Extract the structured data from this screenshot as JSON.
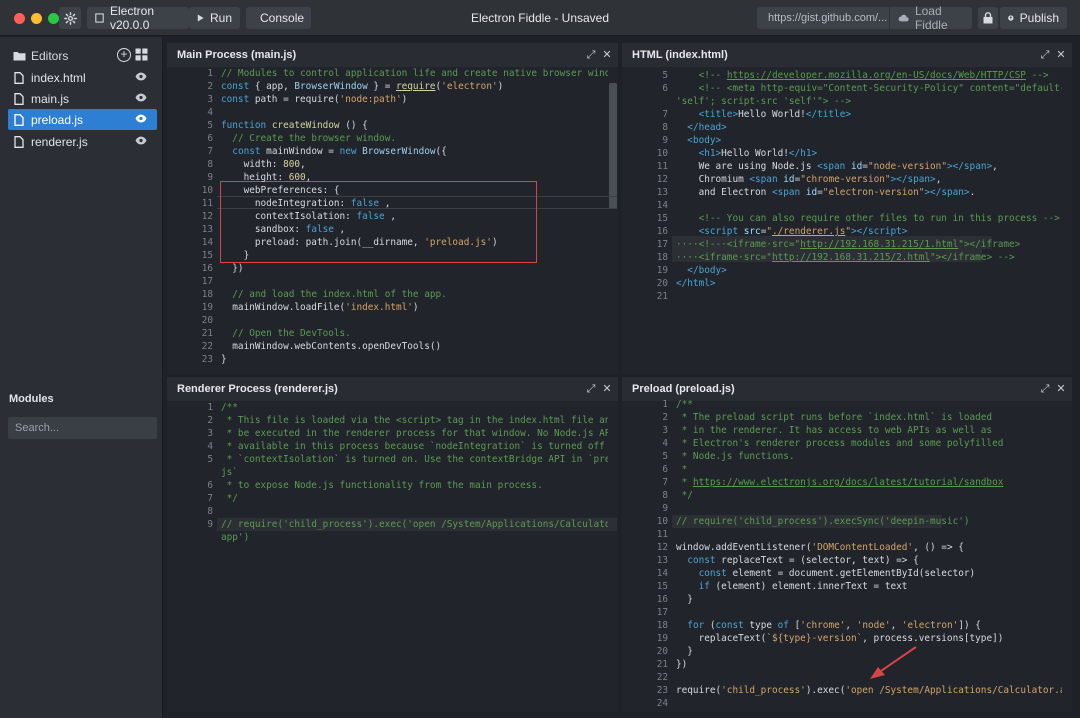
{
  "titlebar": {
    "version_label": "Electron v20.0.0",
    "run_label": "Run",
    "console_label": "Console",
    "window_title": "Electron Fiddle - Unsaved",
    "gist_placeholder": "https://gist.github.com/...",
    "load_label": "Load Fiddle",
    "publish_label": "Publish"
  },
  "sidebar": {
    "editors_label": "Editors",
    "files": [
      {
        "label": "index.html",
        "active": false
      },
      {
        "label": "main.js",
        "active": false
      },
      {
        "label": "preload.js",
        "active": true
      },
      {
        "label": "renderer.js",
        "active": false
      }
    ],
    "modules_label": "Modules",
    "search_placeholder": "Search..."
  },
  "panels": {
    "main": {
      "title": "Main Process (main.js)",
      "lines": [
        {
          "n": "1",
          "h": "<span class=\"c-com\">// Modules to control application life and create native browser window</span>"
        },
        {
          "n": "2",
          "h": "<span class=\"c-kw\">const</span> { app, <span class=\"c-id\">BrowserWindow</span> } = <span class=\"c-fn\"><u>require</u></span>(<span class=\"c-str\">'electron'</span>)"
        },
        {
          "n": "3",
          "h": "<span class=\"c-kw\">const</span> path = require(<span class=\"c-str\">'node:path'</span>)"
        },
        {
          "n": "4",
          "h": ""
        },
        {
          "n": "5",
          "h": "<span class=\"c-kw\">function</span> <span class=\"c-fn\">createWindow</span> () {"
        },
        {
          "n": "6",
          "h": "  <span class=\"c-com\">// Create the browser window.</span>"
        },
        {
          "n": "7",
          "h": "  <span class=\"c-kw\">const</span> mainWindow = <span class=\"c-kw\">new</span> <span class=\"c-id\">BrowserWindow</span>({"
        },
        {
          "n": "8",
          "h": "    width: <span class=\"c-fn\">800</span>,"
        },
        {
          "n": "9",
          "h": "    height: <span class=\"c-fn\">600</span>,"
        },
        {
          "n": "10",
          "h": "    webPreferences: {"
        },
        {
          "n": "11",
          "h": "      nodeIntegration: <span class=\"c-kw\">false</span> ,"
        },
        {
          "n": "12",
          "h": "      contextIsolation: <span class=\"c-kw\">false</span> ,"
        },
        {
          "n": "13",
          "h": "      sandbox: <span class=\"c-kw\">false</span> ,"
        },
        {
          "n": "14",
          "h": "      preload: path.join(__dirname, <span class=\"c-str\">'preload.js'</span>)"
        },
        {
          "n": "15",
          "h": "    }"
        },
        {
          "n": "16",
          "h": "  })"
        },
        {
          "n": "17",
          "h": ""
        },
        {
          "n": "18",
          "h": "  <span class=\"c-com\">// and load the index.html of the app.</span>"
        },
        {
          "n": "19",
          "h": "  mainWindow.loadFile(<span class=\"c-str\">'index.html'</span>)"
        },
        {
          "n": "20",
          "h": ""
        },
        {
          "n": "21",
          "h": "  <span class=\"c-com\">// Open the DevTools.</span>"
        },
        {
          "n": "22",
          "h": "  mainWindow.webContents.openDevTools()"
        },
        {
          "n": "23",
          "h": "}"
        }
      ]
    },
    "html": {
      "title": "HTML (index.html)",
      "lines": [
        {
          "n": "5",
          "h": "    <span class=\"c-com\">&lt;!-- <span class=\"c-link\">https://developer.mozilla.org/en-US/docs/Web/HTTP/CSP</span> --&gt;</span>"
        },
        {
          "n": "6",
          "h": "    <span class=\"c-com\">&lt;!-- &lt;meta http-equiv=\"Content-Security-Policy\" content=\"default-src</span>"
        },
        {
          "n": "",
          "h": "<span class=\"c-com\">'self'; script-src 'self'\"&gt; --&gt;</span>"
        },
        {
          "n": "7",
          "h": "    <span class=\"c-tag\">&lt;title&gt;</span>Hello World!<span class=\"c-tag\">&lt;/title&gt;</span>"
        },
        {
          "n": "8",
          "h": "  <span class=\"c-tag\">&lt;/head&gt;</span>"
        },
        {
          "n": "9",
          "h": "  <span class=\"c-tag\">&lt;body&gt;</span>"
        },
        {
          "n": "10",
          "h": "    <span class=\"c-tag\">&lt;h1&gt;</span>Hello World!<span class=\"c-tag\">&lt;/h1&gt;</span>"
        },
        {
          "n": "11",
          "h": "    We are using Node.js <span class=\"c-tag\">&lt;span</span> <span class=\"c-attr\">id</span>=<span class=\"c-str\">\"node-version\"</span><span class=\"c-tag\">&gt;&lt;/span&gt;</span>,"
        },
        {
          "n": "12",
          "h": "    Chromium <span class=\"c-tag\">&lt;span</span> <span class=\"c-attr\">id</span>=<span class=\"c-str\">\"chrome-version\"</span><span class=\"c-tag\">&gt;&lt;/span&gt;</span>,"
        },
        {
          "n": "13",
          "h": "    and Electron <span class=\"c-tag\">&lt;span</span> <span class=\"c-attr\">id</span>=<span class=\"c-str\">\"electron-version\"</span><span class=\"c-tag\">&gt;&lt;/span&gt;</span>."
        },
        {
          "n": "14",
          "h": ""
        },
        {
          "n": "15",
          "h": "    <span class=\"c-com\">&lt;!-- You can also require other files to run in this process --&gt;</span>"
        },
        {
          "n": "16",
          "h": "    <span class=\"c-tag\">&lt;script</span> <span class=\"c-attr\">src</span>=<span class=\"c-str\">\"<u>./renderer.js</u>\"</span><span class=\"c-tag\">&gt;&lt;/script&gt;</span>"
        },
        {
          "n": "17",
          "h": "<span class=\"c-com\">····&lt;!--·&lt;iframe·src=\"<u>http://192.168.31.215/1.html</u>\"&gt;&lt;/iframe&gt;</span>"
        },
        {
          "n": "18",
          "h": "<span class=\"c-com\">····&lt;iframe·src=\"<u>http://192.168.31.215/2.html</u>\"&gt;&lt;/iframe&gt; --&gt;</span>"
        },
        {
          "n": "19",
          "h": "  <span class=\"c-tag\">&lt;/body&gt;</span>"
        },
        {
          "n": "20",
          "h": "<span class=\"c-tag\">&lt;/html&gt;</span>"
        },
        {
          "n": "21",
          "h": ""
        }
      ]
    },
    "renderer": {
      "title": "Renderer Process (renderer.js)",
      "lines": [
        {
          "n": "1",
          "h": "<span class=\"c-com\">/**</span>"
        },
        {
          "n": "2",
          "h": "<span class=\"c-com\"> * This file is loaded via the &lt;script&gt; tag in the index.html file and will</span>"
        },
        {
          "n": "3",
          "h": "<span class=\"c-com\"> * be executed in the renderer process for that window. No Node.js APIs are</span>"
        },
        {
          "n": "4",
          "h": "<span class=\"c-com\"> * available in this process because `nodeIntegration` is turned off and</span>"
        },
        {
          "n": "5",
          "h": "<span class=\"c-com\"> * `contextIsolation` is turned on. Use the contextBridge API in `preload.</span>"
        },
        {
          "n": "",
          "h": "<span class=\"c-com\">js`</span>"
        },
        {
          "n": "6",
          "h": "<span class=\"c-com\"> * to expose Node.js functionality from the main process.</span>"
        },
        {
          "n": "7",
          "h": "<span class=\"c-com\"> */</span>"
        },
        {
          "n": "8",
          "h": ""
        },
        {
          "n": "9",
          "h": "<span class=\"c-com\">// require('child_process').exec('open /System/Applications/Calculator.</span>"
        },
        {
          "n": "",
          "h": "<span class=\"c-com\">app')</span>"
        }
      ]
    },
    "preload": {
      "title": "Preload (preload.js)",
      "lines": [
        {
          "n": "1",
          "h": "<span class=\"c-com\">/**</span>"
        },
        {
          "n": "2",
          "h": "<span class=\"c-com\"> * The preload script runs before `index.html` is loaded</span>"
        },
        {
          "n": "3",
          "h": "<span class=\"c-com\"> * in the renderer. It has access to web APIs as well as</span>"
        },
        {
          "n": "4",
          "h": "<span class=\"c-com\"> * Electron's renderer process modules and some polyfilled</span>"
        },
        {
          "n": "5",
          "h": "<span class=\"c-com\"> * Node.js functions.</span>"
        },
        {
          "n": "6",
          "h": "<span class=\"c-com\"> *</span>"
        },
        {
          "n": "7",
          "h": "<span class=\"c-com\"> * <span class=\"c-link\">https://www.electronjs.org/docs/latest/tutorial/sandbox</span></span>"
        },
        {
          "n": "8",
          "h": "<span class=\"c-com\"> */</span>"
        },
        {
          "n": "9",
          "h": ""
        },
        {
          "n": "10",
          "h": "<span class=\"c-com\">// require('child_process').execSync('deepin-music')</span>"
        },
        {
          "n": "11",
          "h": ""
        },
        {
          "n": "12",
          "h": "window.addEventListener(<span class=\"c-str\">'DOMContentLoaded'</span>, () =&gt; {"
        },
        {
          "n": "13",
          "h": "  <span class=\"c-kw\">const</span> replaceText = (selector, text) =&gt; {"
        },
        {
          "n": "14",
          "h": "    <span class=\"c-kw\">const</span> element = document.getElementById(selector)"
        },
        {
          "n": "15",
          "h": "    <span class=\"c-kw\">if</span> (element) element.innerText = text"
        },
        {
          "n": "16",
          "h": "  }"
        },
        {
          "n": "17",
          "h": ""
        },
        {
          "n": "18",
          "h": "  <span class=\"c-kw\">for</span> (<span class=\"c-kw\">const</span> type <span class=\"c-kw\">of</span> [<span class=\"c-str\">'chrome'</span>, <span class=\"c-str\">'node'</span>, <span class=\"c-str\">'electron'</span>]) {"
        },
        {
          "n": "19",
          "h": "    replaceText(<span class=\"c-str\">`${type}-version`</span>, process.versions[type])"
        },
        {
          "n": "20",
          "h": "  }"
        },
        {
          "n": "21",
          "h": "})"
        },
        {
          "n": "22",
          "h": ""
        },
        {
          "n": "23",
          "h": "require(<span class=\"c-str\">'child_process'</span>).exec(<span class=\"c-str\">'open /System/Applications/Calculator.app'</span>)"
        },
        {
          "n": "24",
          "h": ""
        }
      ]
    }
  },
  "colors": {
    "accent": "#2d7fd3",
    "annotation_red": "#d64545"
  }
}
